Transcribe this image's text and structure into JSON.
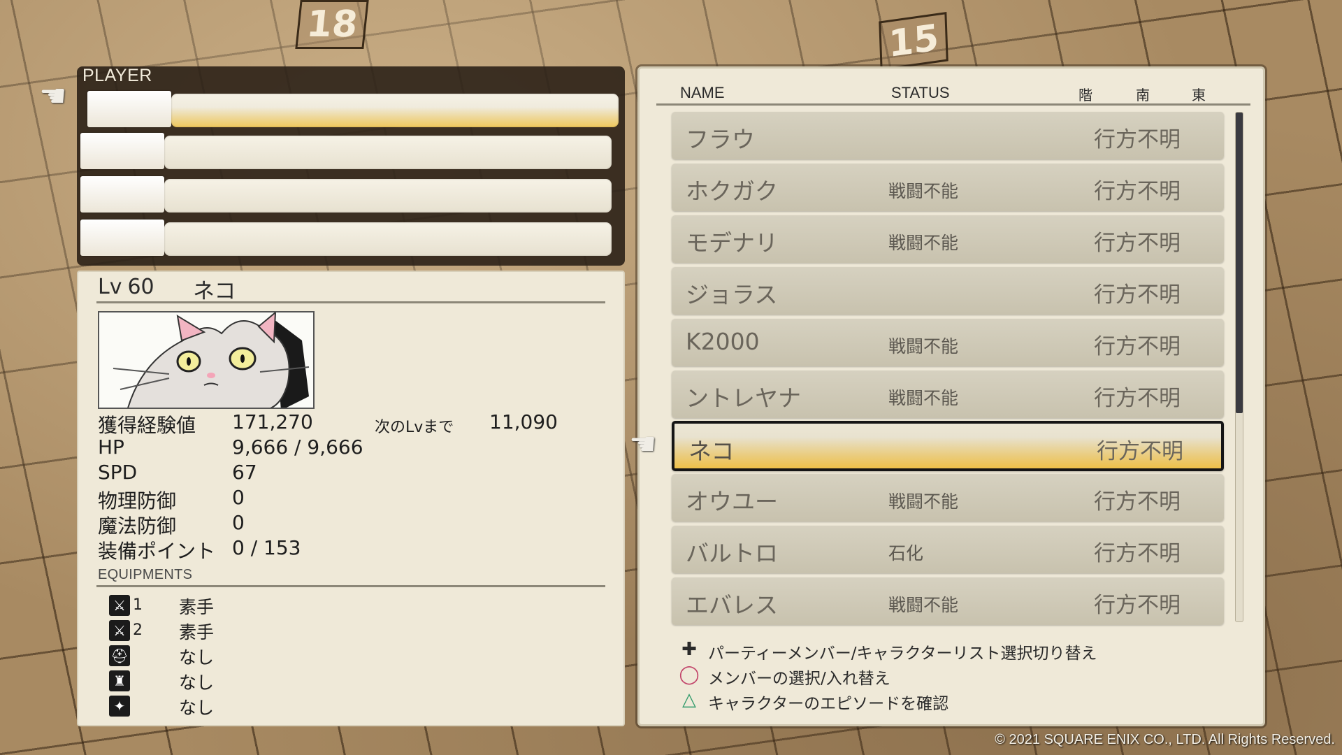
{
  "background": {
    "floor_numbers": [
      "18",
      "15"
    ]
  },
  "player_panel": {
    "label": "PLAYER"
  },
  "detail": {
    "level_label": "Lv",
    "level": "60",
    "name": "ネコ",
    "portrait_icon": "cat-portrait",
    "stats": [
      {
        "label": "獲得経験値",
        "value": "171,270"
      },
      {
        "label": "HP",
        "value": "9,666 / 9,666"
      },
      {
        "label": "SPD",
        "value": "67"
      },
      {
        "label": "物理防御",
        "value": "0"
      },
      {
        "label": "魔法防御",
        "value": "0"
      },
      {
        "label": "装備ポイント",
        "value": "0 / 153"
      }
    ],
    "next_level_label": "次のLvまで",
    "next_level_value": "11,090",
    "equipments_title": "EQUIPMENTS",
    "equipments": [
      {
        "icon": "sword-icon",
        "num": "1",
        "value": "素手"
      },
      {
        "icon": "sword-icon",
        "num": "2",
        "value": "素手"
      },
      {
        "icon": "helmet-icon",
        "num": "",
        "value": "なし"
      },
      {
        "icon": "armor-icon",
        "num": "",
        "value": "なし"
      },
      {
        "icon": "accessory-icon",
        "num": "",
        "value": "なし"
      }
    ]
  },
  "list": {
    "headers": {
      "name": "NAME",
      "status": "STATUS",
      "floor": "階",
      "south": "南",
      "east": "東"
    },
    "rows": [
      {
        "name": "フラウ",
        "status": "",
        "location": "行方不明"
      },
      {
        "name": "ホクガク",
        "status": "戦闘不能",
        "location": "行方不明"
      },
      {
        "name": "モデナリ",
        "status": "戦闘不能",
        "location": "行方不明"
      },
      {
        "name": "ジョラス",
        "status": "",
        "location": "行方不明"
      },
      {
        "name": "K2000",
        "status": "戦闘不能",
        "location": "行方不明"
      },
      {
        "name": "ントレヤナ",
        "status": "戦闘不能",
        "location": "行方不明"
      },
      {
        "name": "ネコ",
        "status": "",
        "location": "行方不明"
      },
      {
        "name": "オウユー",
        "status": "戦闘不能",
        "location": "行方不明"
      },
      {
        "name": "バルトロ",
        "status": "石化",
        "location": "行方不明"
      },
      {
        "name": "エバレス",
        "status": "戦闘不能",
        "location": "行方不明"
      }
    ],
    "selected_index": 6,
    "scroll_fraction": 0.59
  },
  "help": [
    {
      "icon": "dpad-icon",
      "glyph": "✚",
      "text": "パーティーメンバー/キャラクターリスト選択切り替え"
    },
    {
      "icon": "circle-button-icon",
      "glyph": "◯",
      "text": "メンバーの選択/入れ替え"
    },
    {
      "icon": "triangle-button-icon",
      "glyph": "△",
      "text": "キャラクターのエピソードを確認"
    }
  ],
  "colors": {
    "accent_yellow": "#f1c449",
    "panel_bg": "#efe9d8",
    "row_bg": "#d6d1c0"
  },
  "copyright": "© 2021 SQUARE ENIX CO., LTD. All Rights Reserved."
}
